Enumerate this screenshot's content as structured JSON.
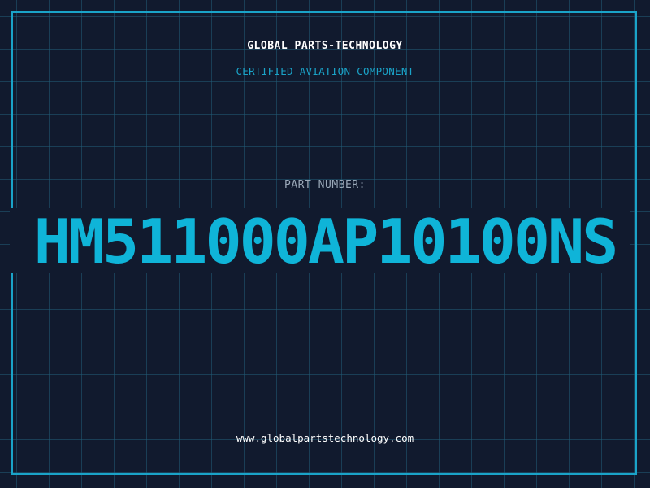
{
  "header": {
    "company": "GLOBAL PARTS-TECHNOLOGY",
    "subtitle": "CERTIFIED AVIATION COMPONENT"
  },
  "part": {
    "label": "PART NUMBER:",
    "number": "HM511000AP10100NS"
  },
  "footer": {
    "url": "www.globalpartstechnology.com"
  },
  "colors": {
    "background": "#111a2e",
    "grid": "#205c76",
    "accent": "#0fb4d8",
    "frame": "#1aa3c8",
    "label": "#9aa8b8",
    "text": "#ffffff"
  }
}
